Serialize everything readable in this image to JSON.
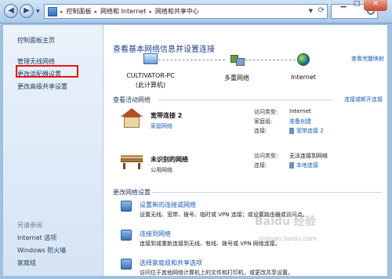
{
  "address": {
    "crumbs": [
      "控制面板",
      "网络和 Internet",
      "网络和共享中心"
    ],
    "search_placeholder": ""
  },
  "sidebar": {
    "home": "控制面板主页",
    "items": [
      "管理无线网络",
      "更改适配器设置",
      "更改高级共享设置"
    ],
    "see_also_title": "另请参阅",
    "see_also": [
      "Internet 选项",
      "Windows 防火墙",
      "家庭组"
    ]
  },
  "main": {
    "title": "查看基本网络信息并设置连接",
    "view_full_map": "查看完整映射",
    "map": {
      "pc_name": "CULTIVATOR-PC",
      "pc_sub": "(此计算机)",
      "middle": "多重网络",
      "internet": "Internet"
    },
    "active_title": "查看活动网络",
    "connect_link": "连接或断开连接",
    "networks": [
      {
        "name": "宽带连接 2",
        "type": "家庭网络",
        "access_label": "访问类型:",
        "access_value": "Internet",
        "homegroup_label": "家庭组:",
        "homegroup_value": "准备创建",
        "conn_label": "连接:",
        "conn_value": "宽带连接 2"
      },
      {
        "name": "未识别的网络",
        "type": "公用网络",
        "access_label": "访问类型:",
        "access_value": "无法连接到网络",
        "conn_label": "连接:",
        "conn_value": "本地连接"
      }
    ],
    "change_title": "更改网络设置",
    "tasks": [
      {
        "title": "设置新的连接或网络",
        "desc": "设置无线、宽带、拨号、临时或 VPN 连接；或设置路由器或访问点。"
      },
      {
        "title": "连接到网络",
        "desc": "连接到或重新连接到无线、有线、拨号或 VPN 网络连接。"
      },
      {
        "title": "选择家庭组和共享选项",
        "desc": "访问位于其他网络计算机上的文件和打印机，或更改共享设置。"
      }
    ]
  },
  "watermark": {
    "text": "Baidu 经验",
    "sub": "jingyan.baidu.com"
  }
}
